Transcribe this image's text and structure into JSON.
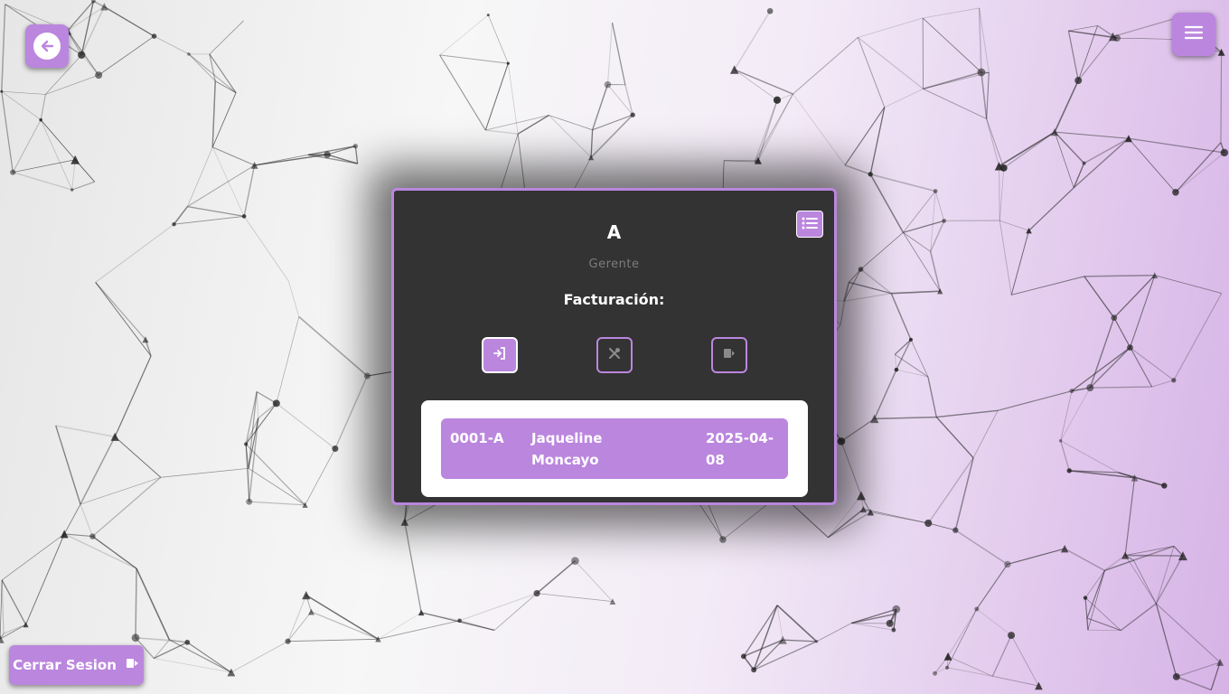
{
  "header": {
    "back_icon": "arrow-left-icon",
    "menu_icon": "hamburger-menu-icon"
  },
  "card": {
    "title": "A",
    "role": "Gerente",
    "section_label": "Facturación:",
    "list_icon": "list-icon",
    "actions": [
      {
        "icon": "login-icon",
        "active": true
      },
      {
        "icon": "tools-icon",
        "active": false
      },
      {
        "icon": "logout-icon",
        "active": false
      }
    ],
    "table": {
      "rows": [
        {
          "code": "0001-A",
          "name": "Jaqueline Moncayo",
          "date": "2025-04-08"
        }
      ]
    }
  },
  "footer": {
    "logout_label": "Cerrar Sesion",
    "logout_icon": "logout-icon"
  },
  "colors": {
    "accent": "#bb86de",
    "card_bg": "#333333",
    "row_bg": "#bb86de"
  }
}
